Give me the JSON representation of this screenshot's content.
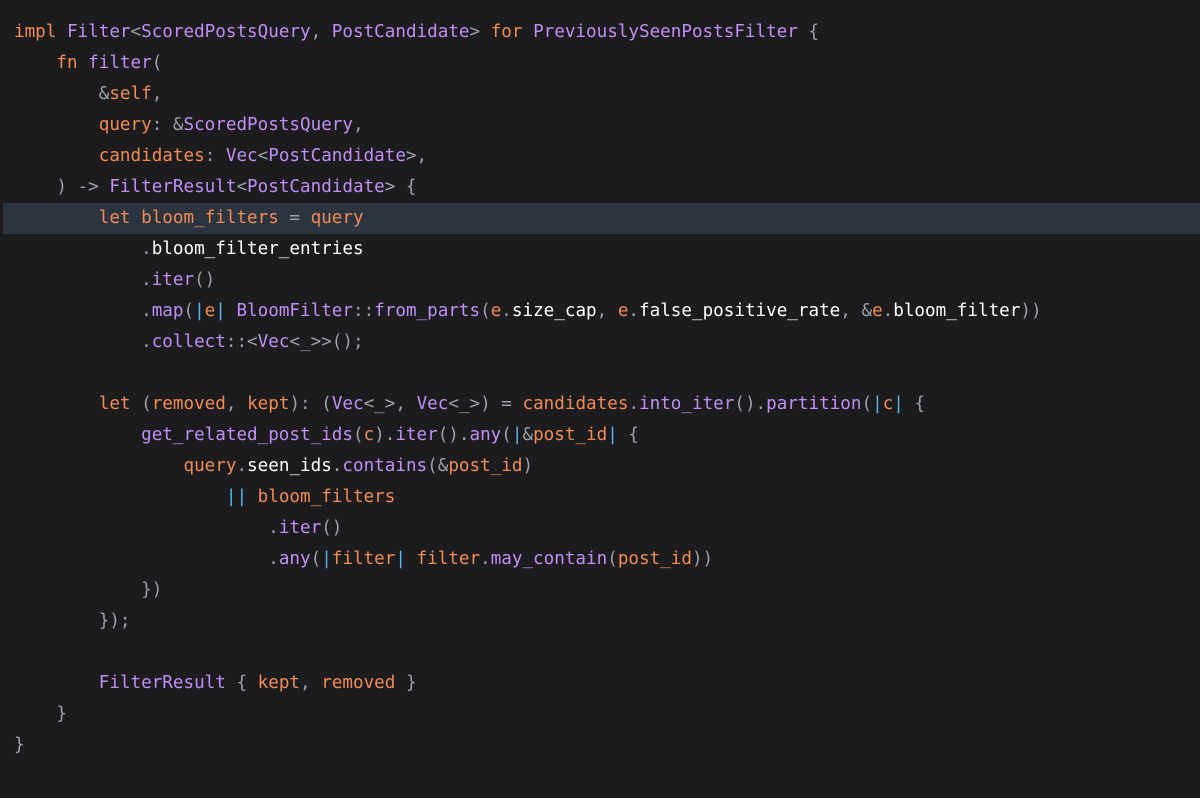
{
  "editor": {
    "current_line_index": 6,
    "colors": {
      "background": "#1c1c1e",
      "current_line_highlight": "#2c3440",
      "keyword": "#f28b54",
      "type": "#bf8ff5",
      "punctuation": "#9da0a8",
      "identifier": "#ffffff",
      "method": "#bf8ff5",
      "parameter": "#f28b54",
      "closure_pipe": "#58b4ee"
    },
    "lines": [
      {
        "indent": "",
        "tokens": [
          {
            "t": "impl",
            "k": "keyword"
          },
          {
            "t": " ",
            "k": "punct"
          },
          {
            "t": "Filter",
            "k": "type"
          },
          {
            "t": "<",
            "k": "punct"
          },
          {
            "t": "ScoredPostsQuery",
            "k": "type"
          },
          {
            "t": ", ",
            "k": "punct"
          },
          {
            "t": "PostCandidate",
            "k": "type"
          },
          {
            "t": "> ",
            "k": "punct"
          },
          {
            "t": "for",
            "k": "keyword"
          },
          {
            "t": " ",
            "k": "punct"
          },
          {
            "t": "PreviouslySeenPostsFilter",
            "k": "type"
          },
          {
            "t": " {",
            "k": "punct"
          }
        ]
      },
      {
        "indent": "    ",
        "tokens": [
          {
            "t": "fn",
            "k": "keyword"
          },
          {
            "t": " ",
            "k": "punct"
          },
          {
            "t": "filter",
            "k": "method"
          },
          {
            "t": "(",
            "k": "punct"
          }
        ]
      },
      {
        "indent": "        ",
        "tokens": [
          {
            "t": "&",
            "k": "punct"
          },
          {
            "t": "self",
            "k": "keyword"
          },
          {
            "t": ",",
            "k": "punct"
          }
        ]
      },
      {
        "indent": "        ",
        "tokens": [
          {
            "t": "query",
            "k": "param"
          },
          {
            "t": ": &",
            "k": "punct"
          },
          {
            "t": "ScoredPostsQuery",
            "k": "type"
          },
          {
            "t": ",",
            "k": "punct"
          }
        ]
      },
      {
        "indent": "        ",
        "tokens": [
          {
            "t": "candidates",
            "k": "param"
          },
          {
            "t": ": ",
            "k": "punct"
          },
          {
            "t": "Vec",
            "k": "type"
          },
          {
            "t": "<",
            "k": "punct"
          },
          {
            "t": "PostCandidate",
            "k": "type"
          },
          {
            "t": ">,",
            "k": "punct"
          }
        ]
      },
      {
        "indent": "    ",
        "tokens": [
          {
            "t": ") -> ",
            "k": "punct"
          },
          {
            "t": "FilterResult",
            "k": "type"
          },
          {
            "t": "<",
            "k": "punct"
          },
          {
            "t": "PostCandidate",
            "k": "type"
          },
          {
            "t": "> {",
            "k": "punct"
          }
        ]
      },
      {
        "indent": "        ",
        "tokens": [
          {
            "t": "let",
            "k": "keyword"
          },
          {
            "t": " ",
            "k": "punct"
          },
          {
            "t": "bloom_filters",
            "k": "param"
          },
          {
            "t": " = ",
            "k": "punct"
          },
          {
            "t": "query",
            "k": "param"
          }
        ]
      },
      {
        "indent": "            ",
        "tokens": [
          {
            "t": ".",
            "k": "punct"
          },
          {
            "t": "bloom_filter_entries",
            "k": "ident"
          }
        ]
      },
      {
        "indent": "            ",
        "tokens": [
          {
            "t": ".",
            "k": "punct"
          },
          {
            "t": "iter",
            "k": "method"
          },
          {
            "t": "()",
            "k": "punct"
          }
        ]
      },
      {
        "indent": "            ",
        "tokens": [
          {
            "t": ".",
            "k": "punct"
          },
          {
            "t": "map",
            "k": "method"
          },
          {
            "t": "(",
            "k": "punct"
          },
          {
            "t": "|",
            "k": "pipe"
          },
          {
            "t": "e",
            "k": "param"
          },
          {
            "t": "|",
            "k": "pipe"
          },
          {
            "t": " ",
            "k": "punct"
          },
          {
            "t": "BloomFilter",
            "k": "type"
          },
          {
            "t": "::",
            "k": "punct"
          },
          {
            "t": "from_parts",
            "k": "method"
          },
          {
            "t": "(",
            "k": "punct"
          },
          {
            "t": "e",
            "k": "param"
          },
          {
            "t": ".",
            "k": "punct"
          },
          {
            "t": "size_cap",
            "k": "ident"
          },
          {
            "t": ", ",
            "k": "punct"
          },
          {
            "t": "e",
            "k": "param"
          },
          {
            "t": ".",
            "k": "punct"
          },
          {
            "t": "false_positive_rate",
            "k": "ident"
          },
          {
            "t": ", &",
            "k": "punct"
          },
          {
            "t": "e",
            "k": "param"
          },
          {
            "t": ".",
            "k": "punct"
          },
          {
            "t": "bloom_filter",
            "k": "ident"
          },
          {
            "t": "))",
            "k": "punct"
          }
        ]
      },
      {
        "indent": "            ",
        "tokens": [
          {
            "t": ".",
            "k": "punct"
          },
          {
            "t": "collect",
            "k": "method"
          },
          {
            "t": "::<",
            "k": "punct"
          },
          {
            "t": "Vec",
            "k": "type"
          },
          {
            "t": "<_>>();",
            "k": "punct"
          }
        ]
      },
      {
        "indent": "",
        "tokens": []
      },
      {
        "indent": "        ",
        "tokens": [
          {
            "t": "let",
            "k": "keyword"
          },
          {
            "t": " (",
            "k": "punct"
          },
          {
            "t": "removed",
            "k": "param"
          },
          {
            "t": ", ",
            "k": "punct"
          },
          {
            "t": "kept",
            "k": "param"
          },
          {
            "t": "): (",
            "k": "punct"
          },
          {
            "t": "Vec",
            "k": "type"
          },
          {
            "t": "<_>, ",
            "k": "punct"
          },
          {
            "t": "Vec",
            "k": "type"
          },
          {
            "t": "<_>) = ",
            "k": "punct"
          },
          {
            "t": "candidates",
            "k": "param"
          },
          {
            "t": ".",
            "k": "punct"
          },
          {
            "t": "into_iter",
            "k": "method"
          },
          {
            "t": "().",
            "k": "punct"
          },
          {
            "t": "partition",
            "k": "method"
          },
          {
            "t": "(",
            "k": "punct"
          },
          {
            "t": "|",
            "k": "pipe"
          },
          {
            "t": "c",
            "k": "param"
          },
          {
            "t": "|",
            "k": "pipe"
          },
          {
            "t": " {",
            "k": "punct"
          }
        ]
      },
      {
        "indent": "            ",
        "tokens": [
          {
            "t": "get_related_post_ids",
            "k": "method"
          },
          {
            "t": "(",
            "k": "punct"
          },
          {
            "t": "c",
            "k": "param"
          },
          {
            "t": ").",
            "k": "punct"
          },
          {
            "t": "iter",
            "k": "method"
          },
          {
            "t": "().",
            "k": "punct"
          },
          {
            "t": "any",
            "k": "method"
          },
          {
            "t": "(",
            "k": "punct"
          },
          {
            "t": "|",
            "k": "pipe"
          },
          {
            "t": "&",
            "k": "punct"
          },
          {
            "t": "post_id",
            "k": "param"
          },
          {
            "t": "|",
            "k": "pipe"
          },
          {
            "t": " {",
            "k": "punct"
          }
        ]
      },
      {
        "indent": "                ",
        "tokens": [
          {
            "t": "query",
            "k": "param"
          },
          {
            "t": ".",
            "k": "punct"
          },
          {
            "t": "seen_ids",
            "k": "ident"
          },
          {
            "t": ".",
            "k": "punct"
          },
          {
            "t": "contains",
            "k": "method"
          },
          {
            "t": "(&",
            "k": "punct"
          },
          {
            "t": "post_id",
            "k": "param"
          },
          {
            "t": ")",
            "k": "punct"
          }
        ]
      },
      {
        "indent": "                    ",
        "tokens": [
          {
            "t": "||",
            "k": "pipe"
          },
          {
            "t": " ",
            "k": "punct"
          },
          {
            "t": "bloom_filters",
            "k": "param"
          }
        ]
      },
      {
        "indent": "                        ",
        "tokens": [
          {
            "t": ".",
            "k": "punct"
          },
          {
            "t": "iter",
            "k": "method"
          },
          {
            "t": "()",
            "k": "punct"
          }
        ]
      },
      {
        "indent": "                        ",
        "tokens": [
          {
            "t": ".",
            "k": "punct"
          },
          {
            "t": "any",
            "k": "method"
          },
          {
            "t": "(",
            "k": "punct"
          },
          {
            "t": "|",
            "k": "pipe"
          },
          {
            "t": "filter",
            "k": "param"
          },
          {
            "t": "|",
            "k": "pipe"
          },
          {
            "t": " ",
            "k": "punct"
          },
          {
            "t": "filter",
            "k": "param"
          },
          {
            "t": ".",
            "k": "punct"
          },
          {
            "t": "may_contain",
            "k": "method"
          },
          {
            "t": "(",
            "k": "punct"
          },
          {
            "t": "post_id",
            "k": "param"
          },
          {
            "t": "))",
            "k": "punct"
          }
        ]
      },
      {
        "indent": "            ",
        "tokens": [
          {
            "t": "})",
            "k": "punct"
          }
        ]
      },
      {
        "indent": "        ",
        "tokens": [
          {
            "t": "});",
            "k": "punct"
          }
        ]
      },
      {
        "indent": "",
        "tokens": []
      },
      {
        "indent": "        ",
        "tokens": [
          {
            "t": "FilterResult",
            "k": "type"
          },
          {
            "t": " { ",
            "k": "punct"
          },
          {
            "t": "kept",
            "k": "param"
          },
          {
            "t": ", ",
            "k": "punct"
          },
          {
            "t": "removed",
            "k": "param"
          },
          {
            "t": " }",
            "k": "punct"
          }
        ]
      },
      {
        "indent": "    ",
        "tokens": [
          {
            "t": "}",
            "k": "punct"
          }
        ]
      },
      {
        "indent": "",
        "tokens": [
          {
            "t": "}",
            "k": "punct"
          }
        ]
      }
    ]
  }
}
